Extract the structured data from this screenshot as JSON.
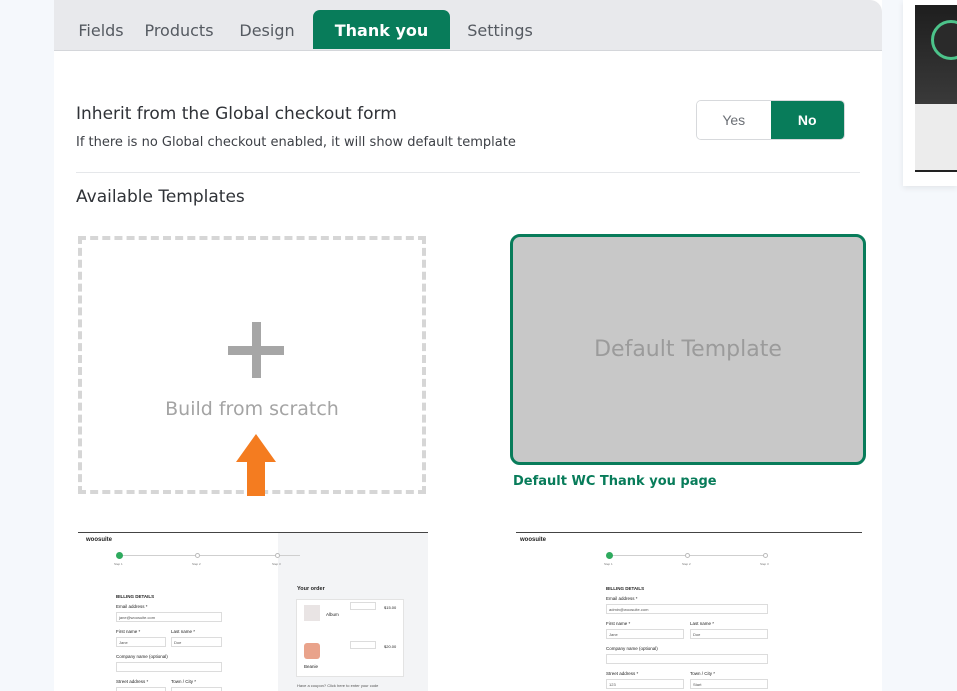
{
  "tabs": [
    {
      "label": "Fields",
      "active": false
    },
    {
      "label": "Products",
      "active": false
    },
    {
      "label": "Design",
      "active": false
    },
    {
      "label": "Thank you page",
      "active": true
    },
    {
      "label": "Settings",
      "active": false
    }
  ],
  "inherit": {
    "title": "Inherit from the Global checkout form",
    "description": "If there is no Global checkout enabled, it will show default template",
    "yes_label": "Yes",
    "no_label": "No",
    "selected": "No"
  },
  "templates": {
    "heading": "Available Templates",
    "scratch_label": "Build from scratch",
    "default_preview_label": "Default Template",
    "default_caption": "Default WC Thank you page"
  },
  "thumb1": {
    "brand": "woosuite",
    "step1": "Step 1",
    "step2": "Step 2",
    "step3": "Step 3",
    "billing": "BILLING DETAILS",
    "email_label": "Email address *",
    "email_value": "jane@woosuite.com",
    "first_label": "First name *",
    "first_value": "Jane",
    "last_label": "Last name *",
    "last_value": "Doe",
    "company_label": "Company name (optional)",
    "street_label": "Street address *",
    "town_label": "Town / City *",
    "order_title": "Your order",
    "item1": "Album",
    "item1_price": "$15.00",
    "item2": "Beanie",
    "item2_price": "$20.00",
    "coupon_text": "Have a coupon? Click here to enter your code"
  },
  "thumb2": {
    "brand": "woosuite",
    "step1": "Step 1",
    "step2": "Step 2",
    "step3": "Step 3",
    "billing": "BILLING DETAILS",
    "email_label": "Email address *",
    "email_value": "admin@woosuite.com",
    "first_label": "First name *",
    "first_value": "Jane",
    "last_label": "Last name *",
    "last_value": "Doe",
    "company_label": "Company name (optional)",
    "street_label": "Street address *",
    "street_value": "123",
    "town_label": "Town / City *",
    "town_value": "Start"
  },
  "colors": {
    "accent": "#087c5a",
    "arrow": "#f47c20",
    "preview_bg": "#c8c8c8"
  }
}
